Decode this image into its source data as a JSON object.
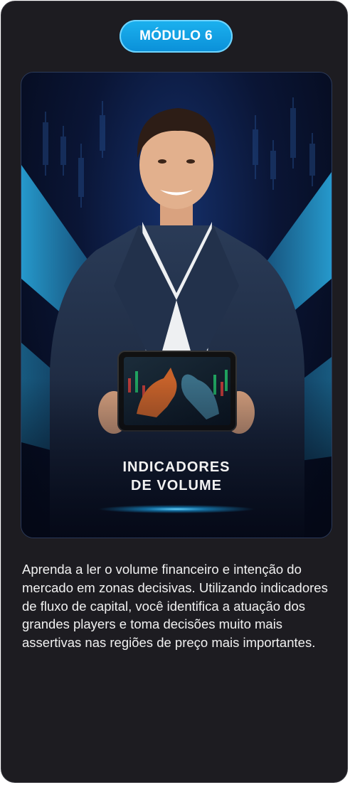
{
  "module": {
    "badge_label": "MÓDULO 6",
    "banner_title": "INDICADORES\nDE VOLUME",
    "description": "Aprenda a ler o volume financeiro e intenção do mercado em zonas decisivas. Utilizando indicadores de fluxo de capital, você identifica a atuação dos grandes players e toma decisões muito mais assertivas nas regiões de preço mais importantes."
  },
  "colors": {
    "card_background": "#1d1c21",
    "accent": "#1cb2ef",
    "banner_glow": "#2fc3ff"
  },
  "icons": [
    "bull-bear-tablet-image",
    "presenter-photo"
  ]
}
